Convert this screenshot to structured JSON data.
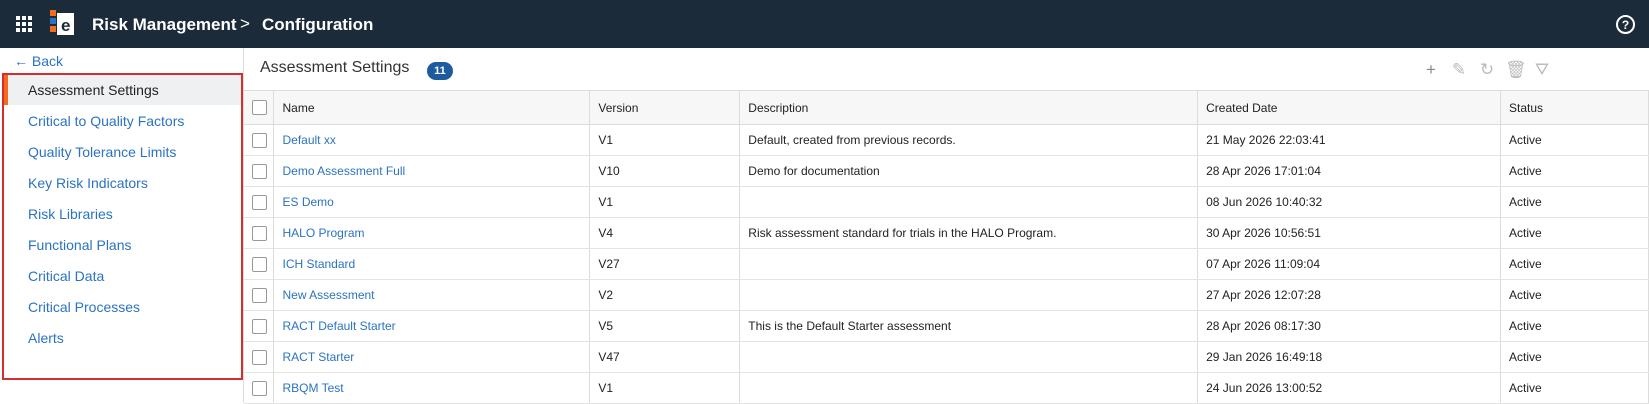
{
  "header": {
    "app_title": "Risk Management",
    "breadcrumb_separator": ">",
    "page": "Configuration",
    "help_glyph": "?",
    "colors": {
      "topbar": "#1c2b3a"
    }
  },
  "sidebar": {
    "back_label": "← Back",
    "items": [
      {
        "label": "Assessment Settings",
        "active": true
      },
      {
        "label": "Critical to Quality Factors"
      },
      {
        "label": "Quality Tolerance Limits"
      },
      {
        "label": "Key Risk Indicators"
      },
      {
        "label": "Risk Libraries"
      },
      {
        "label": "Functional Plans"
      },
      {
        "label": "Critical Data"
      },
      {
        "label": "Critical Processes"
      },
      {
        "label": "Alerts"
      }
    ]
  },
  "main": {
    "title": "Assessment Settings",
    "count": "11",
    "toolbar": {
      "add_glyph": "+",
      "edit_glyph": "✎",
      "copy_glyph": "↻",
      "delete_glyph": "🗑",
      "filter_glyph": "⛛"
    }
  },
  "table": {
    "columns": [
      "Name",
      "Version",
      "Description",
      "Created Date",
      "Status"
    ],
    "rows": [
      [
        "Default xx",
        "V1",
        "Default, created from previous records.",
        "21 May 2026 22:03:41",
        "Active"
      ],
      [
        "Demo Assessment Full",
        "V10",
        "Demo for documentation",
        "28 Apr 2026 17:01:04",
        "Active"
      ],
      [
        "ES Demo",
        "V1",
        "",
        "08 Jun 2026 10:40:32",
        "Active"
      ],
      [
        "HALO Program",
        "V4",
        "Risk assessment standard for trials in the HALO Program.",
        "30 Apr 2026 10:56:51",
        "Active"
      ],
      [
        "ICH Standard",
        "V27",
        "",
        "07 Apr 2026 11:09:04",
        "Active"
      ],
      [
        "New Assessment",
        "V2",
        "",
        "27 Apr 2026 12:07:28",
        "Active"
      ],
      [
        "RACT Default Starter",
        "V5",
        "This is the Default Starter assessment",
        "28 Apr 2026 08:17:30",
        "Active"
      ],
      [
        "RACT Starter",
        "V47",
        "",
        "29 Jan 2026 16:49:18",
        "Active"
      ],
      [
        "RBQM Test",
        "V1",
        "",
        "24 Jun 2026 13:00:52",
        "Active"
      ]
    ]
  }
}
